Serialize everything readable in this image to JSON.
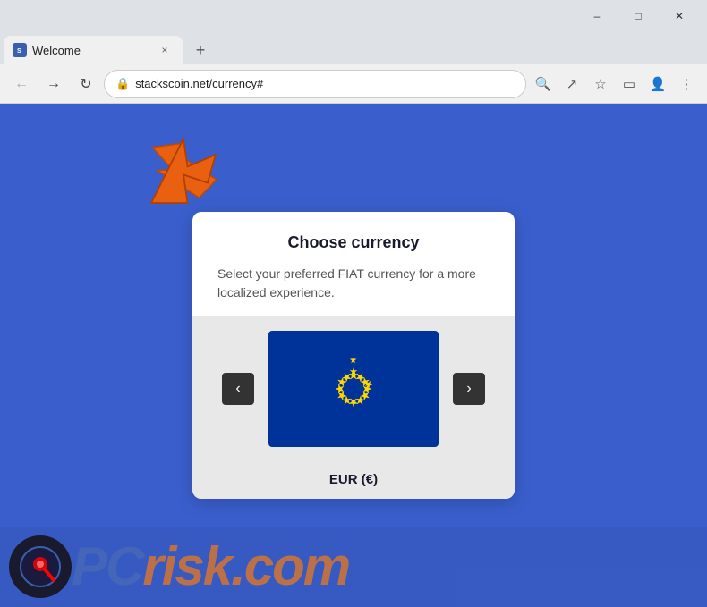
{
  "browser": {
    "tab": {
      "favicon_alt": "stackscoin favicon",
      "title": "Welcome",
      "close_label": "×"
    },
    "new_tab_label": "+",
    "window_controls": {
      "minimize": "–",
      "maximize": "□",
      "close": "✕"
    },
    "nav": {
      "back_label": "←",
      "forward_label": "→",
      "reload_label": "↻"
    },
    "address": {
      "url": "stackscoin.net/currency#"
    },
    "toolbar_icons": {
      "search": "🔍",
      "share": "↗",
      "bookmark": "☆",
      "profile": "👤",
      "menu": "⋮"
    }
  },
  "page": {
    "card": {
      "title": "Choose currency",
      "description": "Select your preferred FIAT currency for a more localized experience.",
      "prev_label": "‹",
      "next_label": "›",
      "currency_label": "EUR (€)"
    }
  },
  "watermark": {
    "brand": "PC",
    "suffix": "risk.com"
  }
}
